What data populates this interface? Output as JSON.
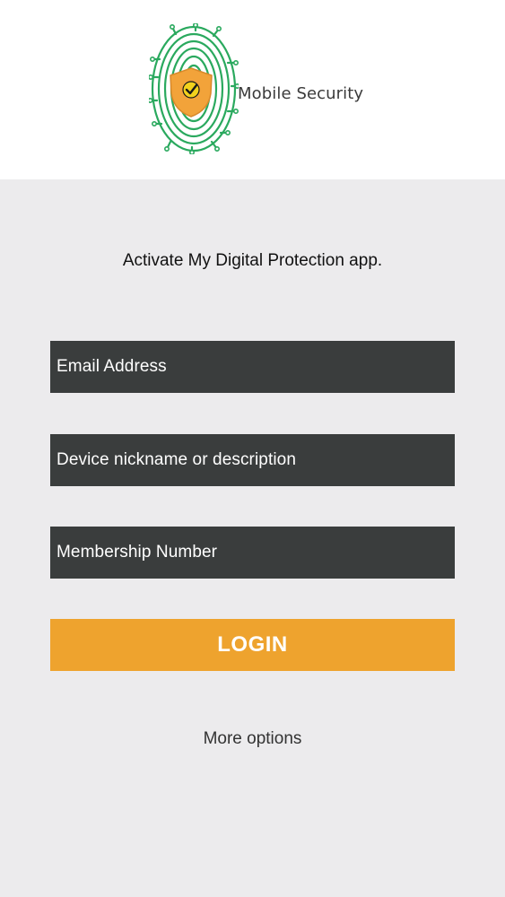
{
  "header": {
    "brand_name": "Mobile Security",
    "logo_icon": "fingerprint-shield-icon"
  },
  "main": {
    "headline": "Activate My Digital Protection app.",
    "fields": [
      {
        "placeholder": "Email Address"
      },
      {
        "placeholder": "Device nickname or description"
      },
      {
        "placeholder": "Membership Number"
      }
    ],
    "login_label": "LOGIN",
    "more_options_label": "More options"
  },
  "colors": {
    "header_bg": "#ffffff",
    "page_bg": "#ecebed",
    "field_bg": "#3a3d3d",
    "accent": "#eea32e",
    "logo_green": "#2aa95e"
  }
}
